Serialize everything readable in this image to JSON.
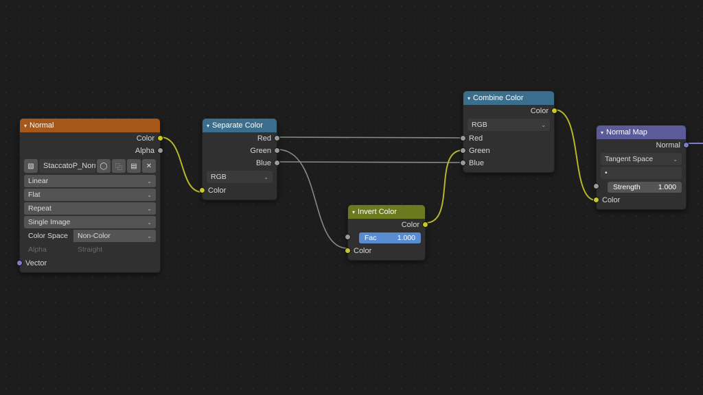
{
  "nodes": {
    "imageTexture": {
      "title": "Normal",
      "out_color": "Color",
      "out_alpha": "Alpha",
      "image_name": "StaccatoP_Norm...",
      "interp": "Linear",
      "projection": "Flat",
      "extension": "Repeat",
      "source": "Single Image",
      "colorspace_lbl": "Color Space",
      "colorspace_val": "Non-Color",
      "alpha_lbl": "Alpha",
      "alpha_val": "Straight",
      "in_vector": "Vector"
    },
    "separateColor": {
      "title": "Separate Color",
      "out_r": "Red",
      "out_g": "Green",
      "out_b": "Blue",
      "mode": "RGB",
      "in_color": "Color"
    },
    "invertColor": {
      "title": "Invert Color",
      "out_color": "Color",
      "fac_lbl": "Fac",
      "fac_val": "1.000",
      "in_color": "Color"
    },
    "combineColor": {
      "title": "Combine Color",
      "out_color": "Color",
      "mode": "RGB",
      "in_r": "Red",
      "in_g": "Green",
      "in_b": "Blue"
    },
    "normalMap": {
      "title": "Normal Map",
      "out_normal": "Normal",
      "space": "Tangent Space",
      "uvmap": "•",
      "strength_lbl": "Strength",
      "strength_val": "1.000",
      "in_color": "Color"
    }
  }
}
